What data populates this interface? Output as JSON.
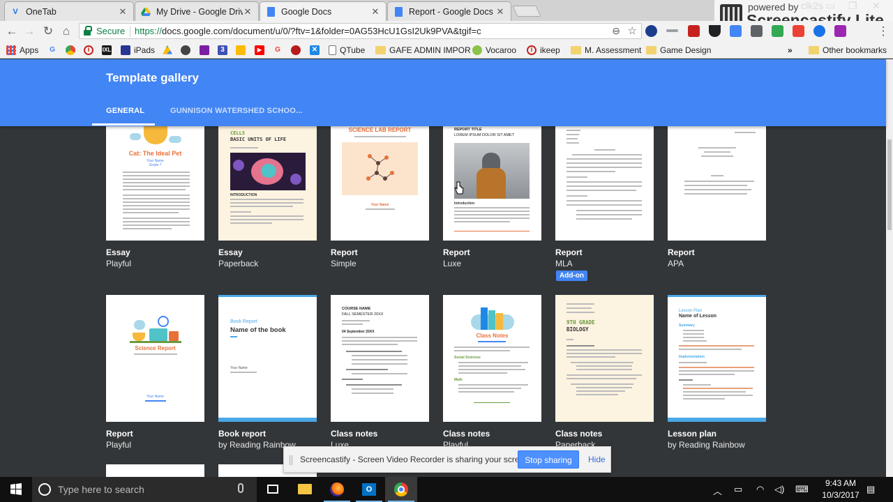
{
  "browser": {
    "tabs": [
      {
        "title": "OneTab",
        "icon": "onetab-icon",
        "active": false
      },
      {
        "title": "My Drive - Google Drive",
        "icon": "google-drive-icon",
        "active": false
      },
      {
        "title": "Google Docs",
        "icon": "google-docs-icon",
        "active": true
      },
      {
        "title": "Report - Google Docs",
        "icon": "google-docs-icon",
        "active": false
      }
    ],
    "secure_label": "Secure",
    "url_protocol": "https://",
    "url_rest": "docs.google.com/document/u/0/?ftv=1&folder=0AG53HcU1GsI2Uk9PVA&tgif=c"
  },
  "watermark": {
    "powered_by": "powered by",
    "brand": "Screencastify Lite"
  },
  "bookmarks": {
    "items": [
      {
        "label": "Apps",
        "icon": "apps-grid-icon"
      },
      {
        "label": "",
        "icon": "google-icon"
      },
      {
        "label": "",
        "icon": "chrome-web-store-icon"
      },
      {
        "label": "",
        "icon": "pinterest-icon"
      },
      {
        "label": "",
        "icon": "ixl-icon"
      },
      {
        "label": "iPads",
        "icon": "ipads-icon"
      },
      {
        "label": "",
        "icon": "google-drive-icon"
      },
      {
        "label": "",
        "icon": "apple-icon"
      },
      {
        "label": "",
        "icon": "bookmark-purple-icon"
      },
      {
        "label": "",
        "icon": "calendar-icon"
      },
      {
        "label": "",
        "icon": "keep-icon"
      },
      {
        "label": "",
        "icon": "youtube-icon"
      },
      {
        "label": "",
        "icon": "google-icon"
      },
      {
        "label": "",
        "icon": "bookmark-red-icon"
      },
      {
        "label": "",
        "icon": "crossword-icon"
      },
      {
        "label": "QTube",
        "icon": "page-icon"
      },
      {
        "label": "GAFE ADMIN IMPOR",
        "icon": "folder-icon"
      },
      {
        "label": "Vocaroo",
        "icon": "vocaroo-icon"
      },
      {
        "label": "ikeep",
        "icon": "pinterest-icon"
      },
      {
        "label": "M. Assessment",
        "icon": "folder-icon"
      },
      {
        "label": "Game Design",
        "icon": "folder-icon"
      }
    ],
    "overflow": "»",
    "other": "Other bookmarks"
  },
  "gallery": {
    "title": "Template gallery",
    "tabs": [
      "GENERAL",
      "GUNNISON WATERSHED SCHOO..."
    ],
    "row1": [
      {
        "line1": "Essay",
        "line2": "Playful"
      },
      {
        "line1": "Essay",
        "line2": "Paperback"
      },
      {
        "line1": "Report",
        "line2": "Simple"
      },
      {
        "line1": "Report",
        "line2": "Luxe"
      },
      {
        "line1": "Report",
        "line2": "MLA"
      },
      {
        "line1": "Report",
        "line2": "APA"
      }
    ],
    "addon_badge": "Add-on",
    "row2": [
      {
        "line1": "Report",
        "line2": "Playful"
      },
      {
        "line1": "Book report",
        "line2": "by Reading Rainbow"
      },
      {
        "line1": "Class notes",
        "line2": "Luxe"
      },
      {
        "line1": "Class notes",
        "line2": "Playful"
      },
      {
        "line1": "Class notes",
        "line2": "Paperback"
      },
      {
        "line1": "Lesson plan",
        "line2": "by Reading Rainbow"
      }
    ],
    "thumbs": {
      "essay_playful_title": "Cat: The Ideal Pet",
      "essay_playful_name": "Your Name",
      "essay_playful_grade": "Grade 7",
      "essay_paperback_title1": "CELLS",
      "essay_paperback_title2": "BASIC UNITS OF LIFE",
      "essay_paperback_intro": "INTRODUCTION",
      "report_simple_title": "SCIENCE LAB REPORT",
      "report_simple_name": "Your Name",
      "report_luxe_title1": "REPORT TITLE",
      "report_luxe_title2": "LOREM IPSUM DOLOR SIT AMET",
      "report_luxe_intro": "Introduction",
      "report_playful_title": "Science Report",
      "report_playful_name": "Your Name",
      "book_report_label": "Book Report",
      "book_report_title": "Name of the book",
      "book_report_name": "Your Name",
      "classnotes_luxe_course": "COURSE NAME",
      "classnotes_luxe_semester": "FALL SEMESTER 20XX",
      "classnotes_luxe_date": "04 September 20XX",
      "classnotes_playful_title": "Class Notes",
      "classnotes_playful_social": "Social Sciences",
      "classnotes_playful_math": "Math",
      "classnotes_paperback_grade": "9TH GRADE",
      "classnotes_paperback_subject": "BIOLOGY",
      "lesson_plan_label": "Lesson Plan",
      "lesson_plan_title": "Name of Lesson",
      "lesson_plan_summary": "Summary",
      "lesson_plan_impl": "Implementation"
    }
  },
  "share_bar": {
    "message": "Screencastify - Screen Video Recorder is sharing your screen.",
    "stop": "Stop sharing",
    "hide": "Hide"
  },
  "taskbar": {
    "search_placeholder": "Type here to search",
    "time": "9:43 AM",
    "date": "10/3/2017"
  },
  "colors": {
    "gallery_blue": "#4285f4",
    "gallery_bg": "#323639",
    "secure_green": "#0b8043",
    "accent_orange": "#e8713a"
  }
}
